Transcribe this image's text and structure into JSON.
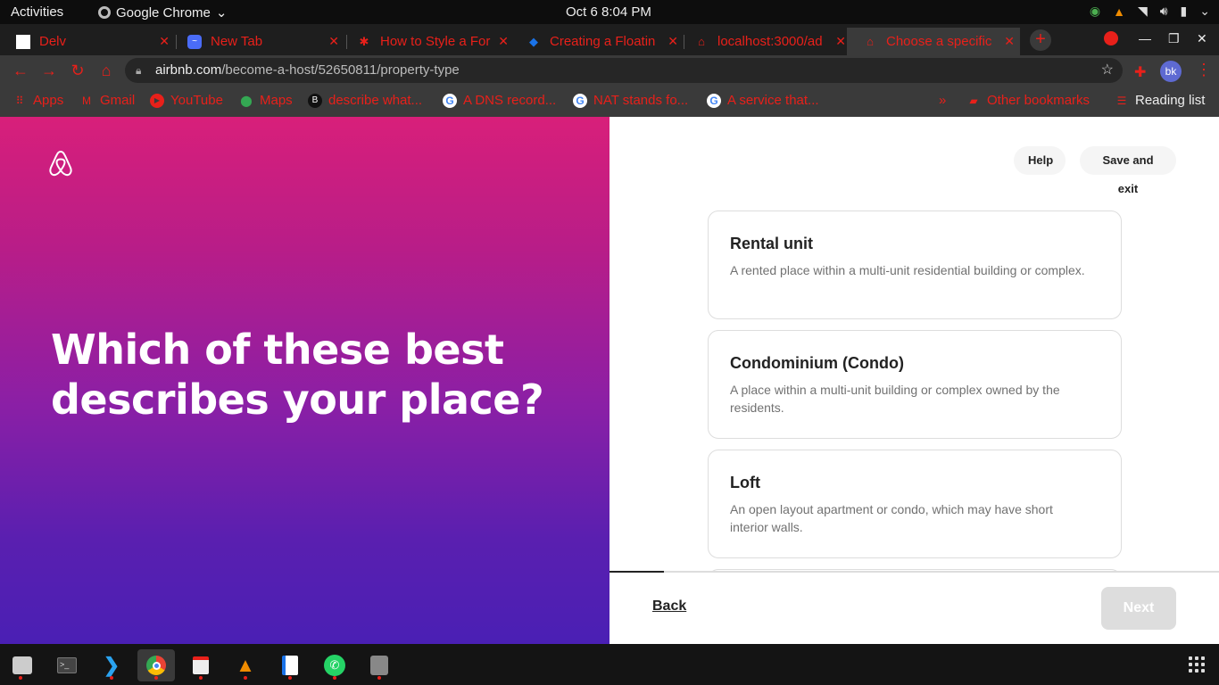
{
  "system": {
    "activities": "Activities",
    "app_name": "Google Chrome",
    "clock": "Oct 6   8:04 PM"
  },
  "tabs": [
    {
      "label": "Delv",
      "icon": "page-icon"
    },
    {
      "label": "New Tab",
      "icon": "messenger-icon"
    },
    {
      "label": "How to Style a For",
      "icon": "asterisk-icon"
    },
    {
      "label": "Creating a Floatin",
      "icon": "diamond-icon"
    },
    {
      "label": "localhost:3000/ad",
      "icon": "airbnb-icon"
    },
    {
      "label": "Choose a specific",
      "icon": "airbnb-icon"
    }
  ],
  "address": {
    "host": "airbnb.com",
    "path": "/become-a-host/52650811/property-type"
  },
  "profile": {
    "initials": "bk"
  },
  "bookmarks": [
    {
      "label": "Apps"
    },
    {
      "label": "Gmail"
    },
    {
      "label": "YouTube"
    },
    {
      "label": "Maps"
    },
    {
      "label": "describe what..."
    },
    {
      "label": "A DNS record..."
    },
    {
      "label": "NAT stands fo..."
    },
    {
      "label": "A service that..."
    }
  ],
  "bookmarks_extra": {
    "overflow": "»",
    "other": "Other bookmarks",
    "reading": "Reading list"
  },
  "hero": {
    "heading": "Which of these best describes your place?"
  },
  "header_actions": {
    "help": "Help",
    "save_exit": "Save and exit"
  },
  "options": [
    {
      "title": "Rental unit",
      "desc": "A rented place within a multi-unit residential building or complex."
    },
    {
      "title": "Condominium (Condo)",
      "desc": "A place within a multi-unit building or complex owned by the residents."
    },
    {
      "title": "Loft",
      "desc": "An open layout apartment or condo, which may have short interior walls."
    }
  ],
  "footer": {
    "back": "Back",
    "next": "Next",
    "progress": 0.09
  },
  "colors": {
    "accent_red": "#e8201a",
    "gradient_top": "#d81f7a",
    "gradient_bottom": "#4a1fb4"
  }
}
